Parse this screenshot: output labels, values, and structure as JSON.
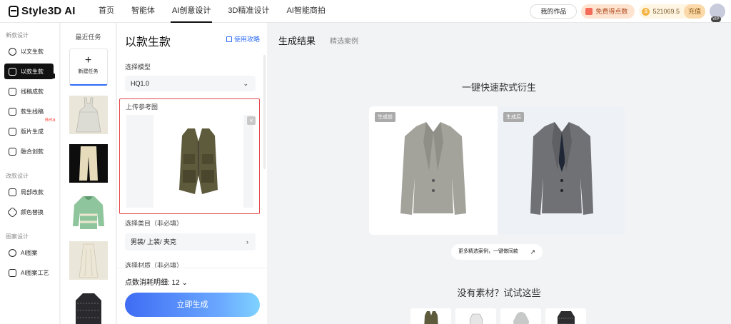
{
  "topbar": {
    "logo": "Style3D AI",
    "nav": [
      "首页",
      "智能体",
      "AI创意设计",
      "3D精准设计",
      "AI智能商拍"
    ],
    "my_works": "我的作品",
    "free_points": "免费得点数",
    "balance": "521069.5",
    "recharge": "充值",
    "vip": "VIP"
  },
  "sidebar": {
    "sec1": "新款设计",
    "sec2": "改款设计",
    "sec3": "图案设计",
    "items": [
      "以文生款",
      "以款生款",
      "线稿成款",
      "款生线稿",
      "版片生成",
      "融合创款",
      "局部改款",
      "颜色替换",
      "AI图案",
      "AI图案工艺"
    ],
    "beta": "Beta"
  },
  "tasks": {
    "title": "最近任务",
    "new_task": "新建任务"
  },
  "form": {
    "title": "以款生款",
    "guide": "使用攻略",
    "model_label": "选择模型",
    "model_value": "HQ1.0",
    "upload_label": "上传参考图",
    "category_label": "选择类目（非必填）",
    "category_value": "男装/ 上装/ 夹克",
    "material_label": "选择材质（非必填）",
    "cost_label": "点数消耗明细: 12",
    "generate": "立即生成"
  },
  "main": {
    "tab_result": "生成结果",
    "tab_case": "精选案例",
    "headline": "一键快速款式衍生",
    "before_tag": "生成前",
    "after_tag": "生成后",
    "more_cases": "更多精选案例，一键做同款",
    "no_material": "没有素材？试试这些"
  },
  "colors": {
    "accent": "#2f6cf6",
    "upload_border": "#e5484d"
  }
}
